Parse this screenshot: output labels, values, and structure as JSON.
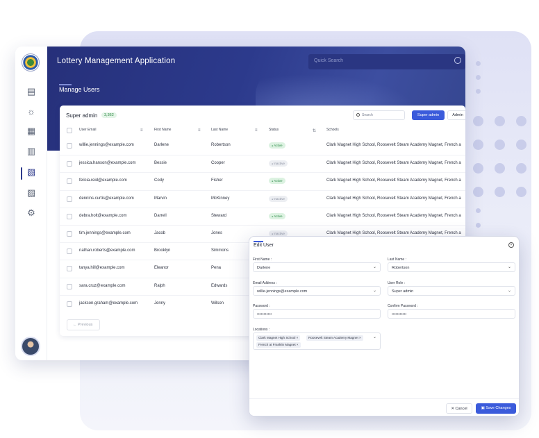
{
  "app": {
    "title": "Lottery Management Application",
    "quick_search_placeholder": "Quick Search",
    "page_title": "Manage Users"
  },
  "sidebar": {
    "items": [
      {
        "icon": "book-icon",
        "glyph": "▤"
      },
      {
        "icon": "sun-icon",
        "glyph": "☼"
      },
      {
        "icon": "calendar-icon",
        "glyph": "▦"
      },
      {
        "icon": "clipboard-icon",
        "glyph": "▥"
      },
      {
        "icon": "users-doc-icon",
        "glyph": "▧"
      },
      {
        "icon": "document-user-icon",
        "glyph": "▨"
      },
      {
        "icon": "gear-icon",
        "glyph": "⚙"
      }
    ],
    "active_index": 4
  },
  "panel": {
    "title": "Super admin",
    "count": "3,362",
    "search_placeholder": "Search",
    "btn_super_admin": "Super admin",
    "btn_admin": "Admin",
    "columns": [
      "User Email",
      "First Name",
      "Last Name",
      "Status",
      "Schools"
    ],
    "rows": [
      {
        "email": "willie.jennings@example.com",
        "first": "Darlene",
        "last": "Robertson",
        "status": "Active",
        "schools": "Clark Magnet High School, Roosevelt Steam Academy Magnet, French a"
      },
      {
        "email": "jessica.hanson@example.com",
        "first": "Bessie",
        "last": "Cooper",
        "status": "Inactive",
        "schools": "Clark Magnet High School, Roosevelt Steam Academy Magnet, French a"
      },
      {
        "email": "felicia.reid@example.com",
        "first": "Cody",
        "last": "Fisher",
        "status": "Active",
        "schools": "Clark Magnet High School, Roosevelt Steam Academy Magnet, French a"
      },
      {
        "email": "dennins.curtis@example.com",
        "first": "Marvin",
        "last": "McKinney",
        "status": "Inactive",
        "schools": "Clark Magnet High School, Roosevelt Steam Academy Magnet, French a"
      },
      {
        "email": "debra.holt@example.com",
        "first": "Darrell",
        "last": "Steward",
        "status": "Active",
        "schools": "Clark Magnet High School, Roosevelt Steam Academy Magnet, French a"
      },
      {
        "email": "tim.jennings@example.com",
        "first": "Jacob",
        "last": "Jones",
        "status": "Inactive",
        "schools": "Clark Magnet High School, Roosevelt Steam Academy Magnet, French a"
      },
      {
        "email": "nathan.roberts@example.com",
        "first": "Brooklyn",
        "last": "Simmons",
        "status": "",
        "schools": ""
      },
      {
        "email": "tanya.hill@example.com",
        "first": "Eleanor",
        "last": "Pena",
        "status": "",
        "schools": ""
      },
      {
        "email": "sara.cruz@example.com",
        "first": "Ralph",
        "last": "Edwards",
        "status": "",
        "schools": ""
      },
      {
        "email": "jackson.graham@example.com",
        "first": "Jenny",
        "last": "Wilson",
        "status": "",
        "schools": ""
      }
    ],
    "previous_label": "Previous"
  },
  "modal": {
    "title": "Edit User",
    "first_name_label": "First Name :",
    "first_name": "Darlene",
    "last_name_label": "Last Name :",
    "last_name": "Robertson",
    "email_label": "Email Address :",
    "email": "willie.jennings@example.com",
    "role_label": "User Role :",
    "role": "Super admin",
    "password_label": "Password :",
    "password": "•••••••••••",
    "confirm_label": "Confirm Password :",
    "confirm": "•••••••••••",
    "locations_label": "Locations :",
    "locations": [
      "Clark Magnet High School",
      "Roosevelt Steam Academy Magnet",
      "French at Franklin Magnet"
    ],
    "cancel": "Cancel",
    "save": "Save Changes"
  },
  "colors": {
    "brand": "#2c3a8c",
    "accent": "#3b5bdb",
    "active": "#2b8a47"
  }
}
